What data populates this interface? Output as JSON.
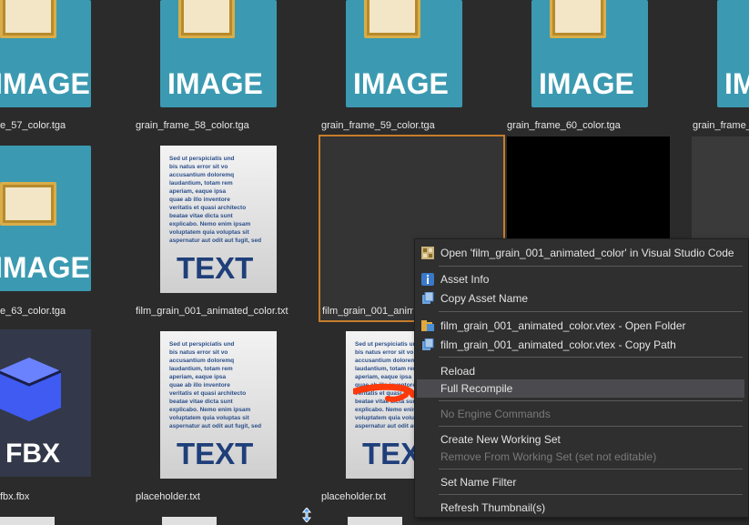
{
  "tiles": {
    "r1c1": {
      "label": "e_57_color.tga",
      "icon_word": "IMAGE"
    },
    "r1c2": {
      "label": "grain_frame_58_color.tga",
      "icon_word": "IMAGE"
    },
    "r1c3": {
      "label": "grain_frame_59_color.tga",
      "icon_word": "IMAGE"
    },
    "r1c4": {
      "label": "grain_frame_60_color.tga",
      "icon_word": "IMAGE"
    },
    "r1c5": {
      "label": "grain_frame_",
      "icon_word": "IM"
    },
    "r2c1": {
      "label": "e_63_color.tga",
      "icon_word": "IMAGE"
    },
    "r2c2": {
      "label": "film_grain_001_animated_color.txt",
      "icon_word": "TEXT"
    },
    "r2c3": {
      "label": "film_grain_001_animat"
    },
    "r3c1": {
      "label": "fbx.fbx",
      "icon_word": "FBX"
    },
    "r3c2": {
      "label": "placeholder.txt",
      "icon_word": "TEXT"
    },
    "r3c3": {
      "label": "placeholder.txt",
      "icon_word": "TEX"
    }
  },
  "text_icon_lines": "Sed ut perspiciatis und\nbis natus error sit vo\naccusantium doloremq\nlaudantium, totam rem\naperiam, eaque ipsa\nquae ab illo inventore\nveritatis et quasi architecto\nbeatae vitae dicta sunt\nexplicabo. Nemo enim ipsam\nvoluptatem quia voluptas sit\naspernatur aut odit aut fugit, sed",
  "context_menu": {
    "items": [
      {
        "label": "Open 'film_grain_001_animated_color' in Visual Studio Code",
        "icon": "vscode-icon"
      },
      {
        "label": "Asset Info",
        "icon": "info-icon"
      },
      {
        "label": "Copy Asset Name",
        "icon": "copy-icon"
      },
      {
        "label": "film_grain_001_animated_color.vtex - Open Folder",
        "icon": "folder-icon"
      },
      {
        "label": "film_grain_001_animated_color.vtex - Copy Path",
        "icon": "copy-path-icon"
      },
      {
        "label": "Reload"
      },
      {
        "label": "Full Recompile"
      },
      {
        "label": "No Engine Commands"
      },
      {
        "label": "Create New Working Set"
      },
      {
        "label": "Remove From Working Set (set not editable)"
      },
      {
        "label": "Set Name Filter"
      },
      {
        "label": "Refresh Thumbnail(s)"
      }
    ]
  },
  "colors": {
    "background": "#2b2b2b",
    "selection_border": "#c77c2c",
    "image_icon_blue": "#3b9ab1",
    "menu_highlight": "#4b4b4f"
  }
}
